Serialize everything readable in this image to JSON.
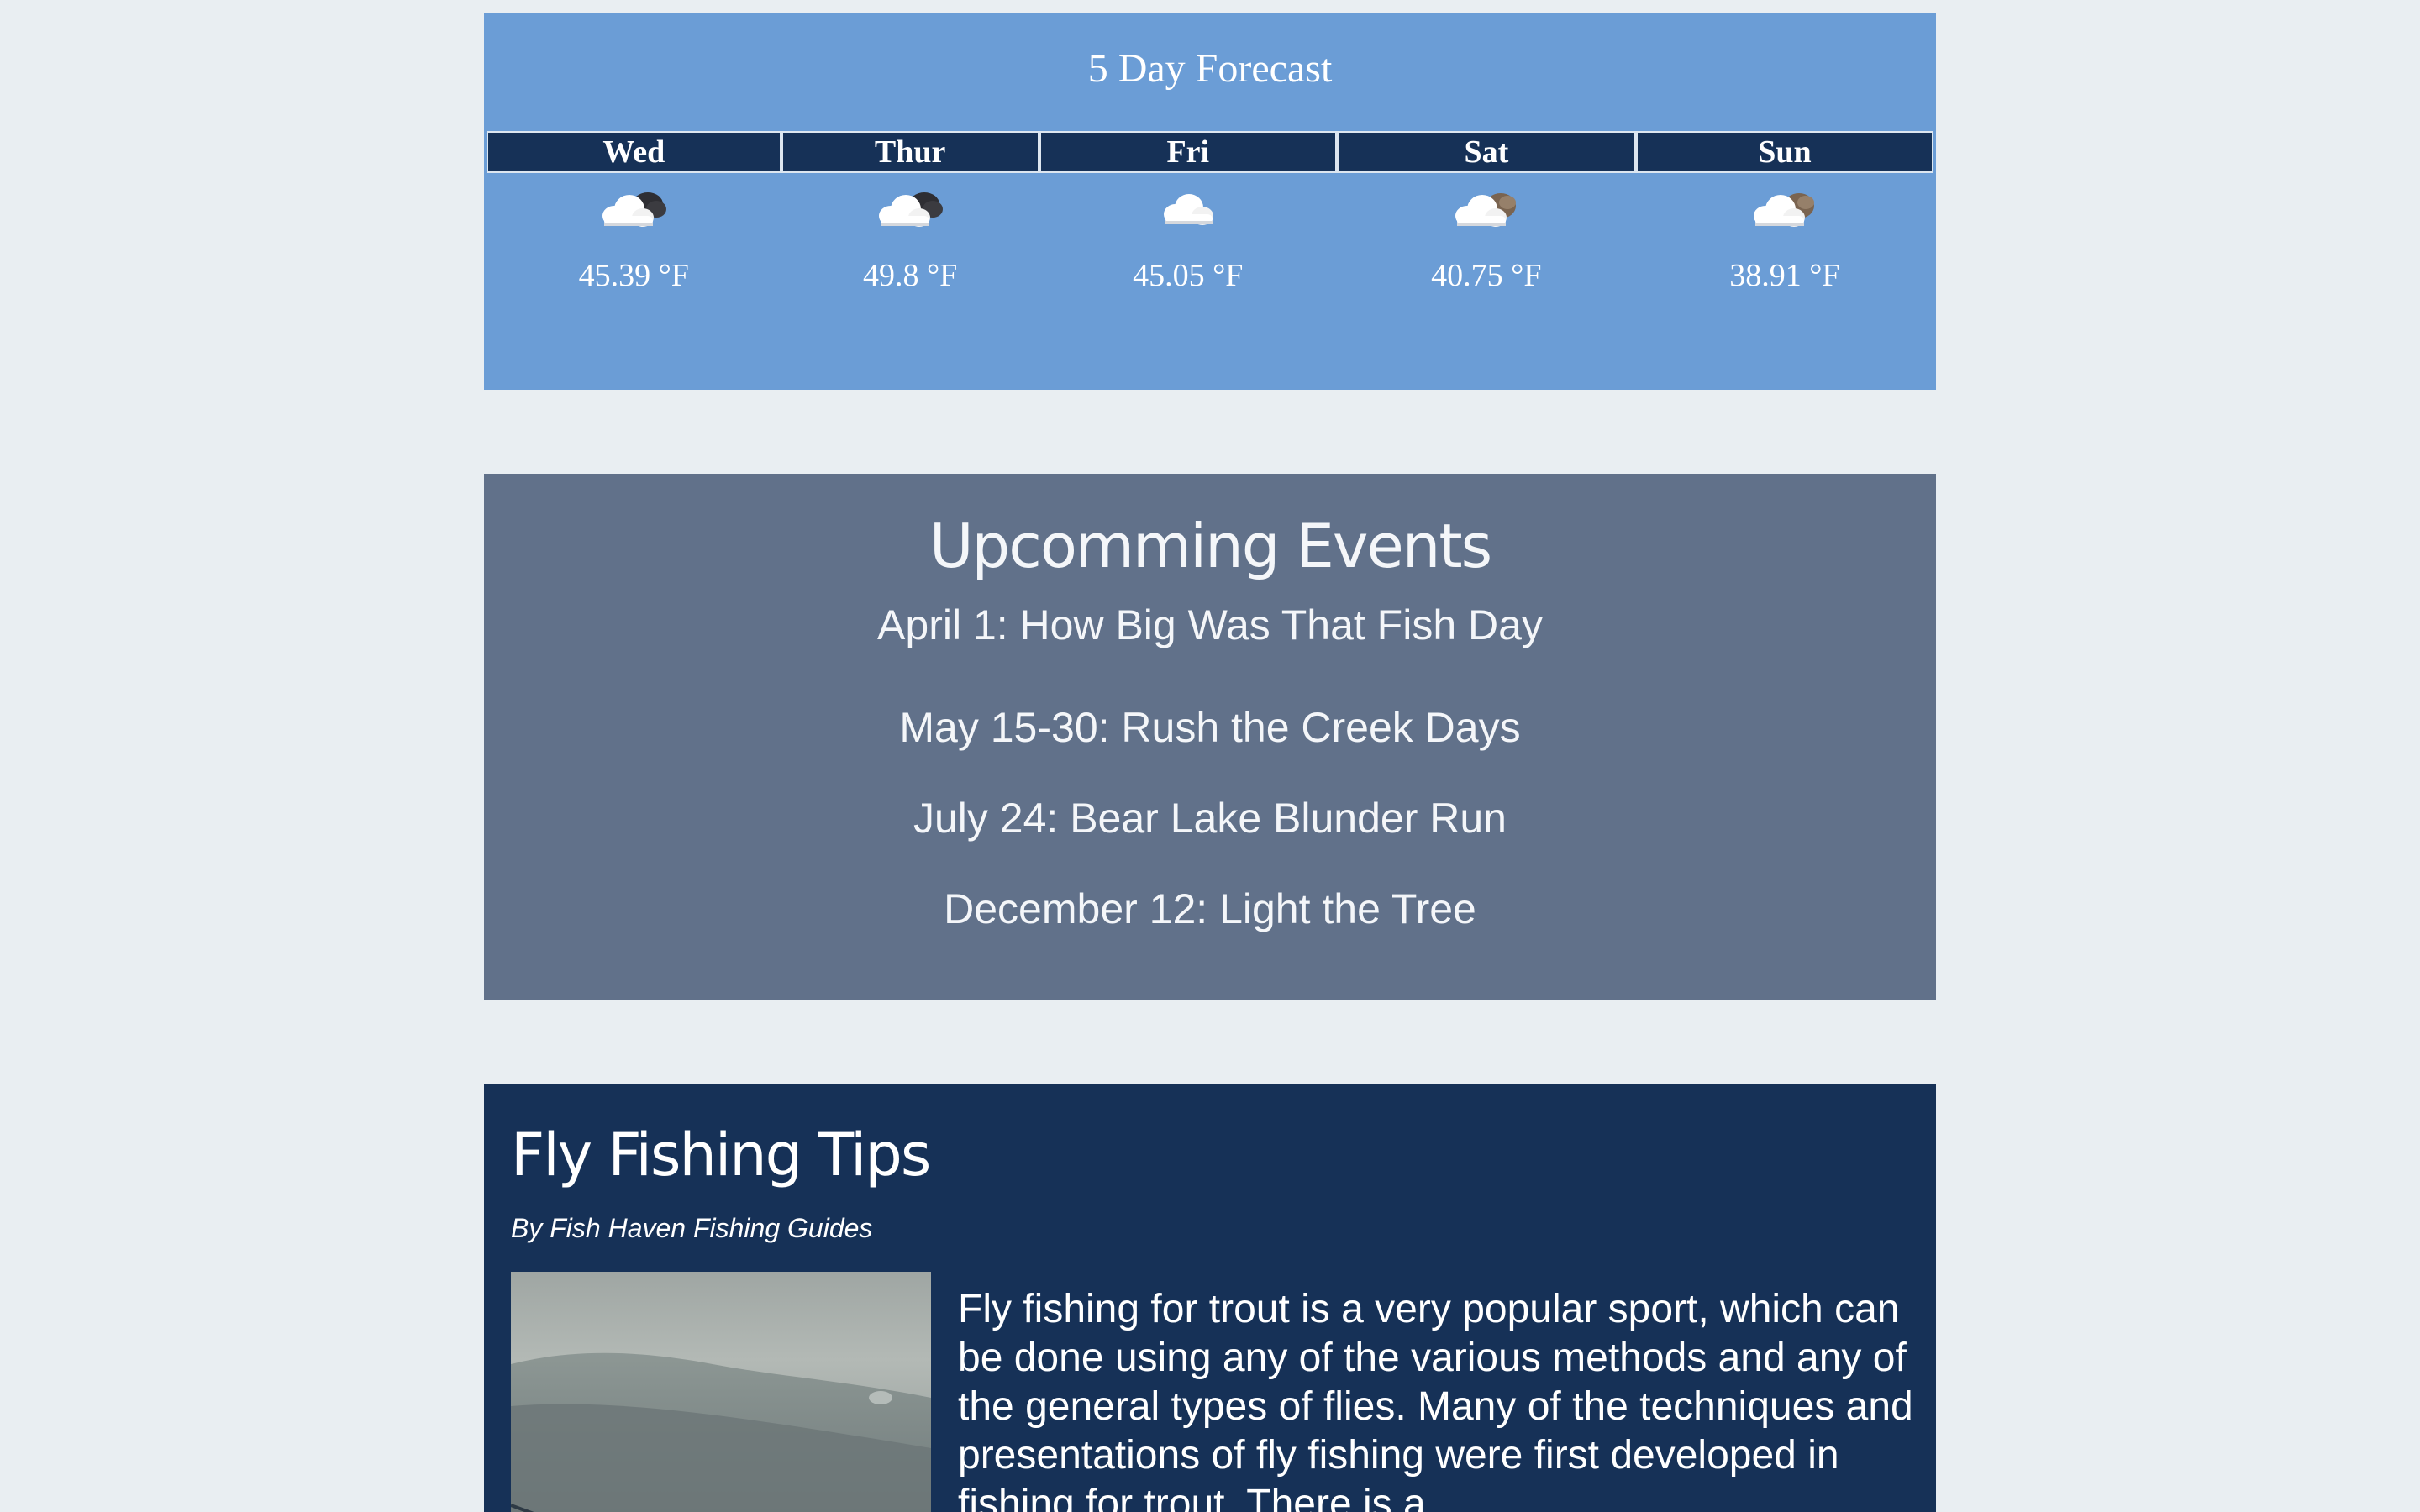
{
  "forecast": {
    "title": "5 Day Forecast",
    "days": [
      {
        "day": "Wed",
        "icon": "cloud-dark-sun-icon",
        "temp": "45.39 °F"
      },
      {
        "day": "Thur",
        "icon": "cloud-dark-sun-icon",
        "temp": "49.8 °F"
      },
      {
        "day": "Fri",
        "icon": "cloud-icon",
        "temp": "45.05 °F"
      },
      {
        "day": "Sat",
        "icon": "cloud-brown-icon",
        "temp": "40.75 °F"
      },
      {
        "day": "Sun",
        "icon": "cloud-brown-icon",
        "temp": "38.91 °F"
      }
    ]
  },
  "events": {
    "title": "Upcomming Events",
    "items": [
      "April 1: How Big Was That Fish Day",
      "May 15-30: Rush the Creek Days",
      "July 24: Bear Lake Blunder Run",
      "December 12: Light the Tree"
    ]
  },
  "tips": {
    "title": "Fly Fishing Tips",
    "byline": "By Fish Haven Fishing Guides",
    "body": "Fly fishing for trout is a very popular sport, which can be done using any of the various methods and any of the general types of flies. Many of the techniques and presentations of fly fishing were first developed in fishing for trout. There is a"
  },
  "colors": {
    "page_bg": "#e9eef2",
    "forecast_bg": "#6b9dd6",
    "header_bg": "#163157",
    "events_bg": "#61718a",
    "tips_bg": "#163157"
  }
}
